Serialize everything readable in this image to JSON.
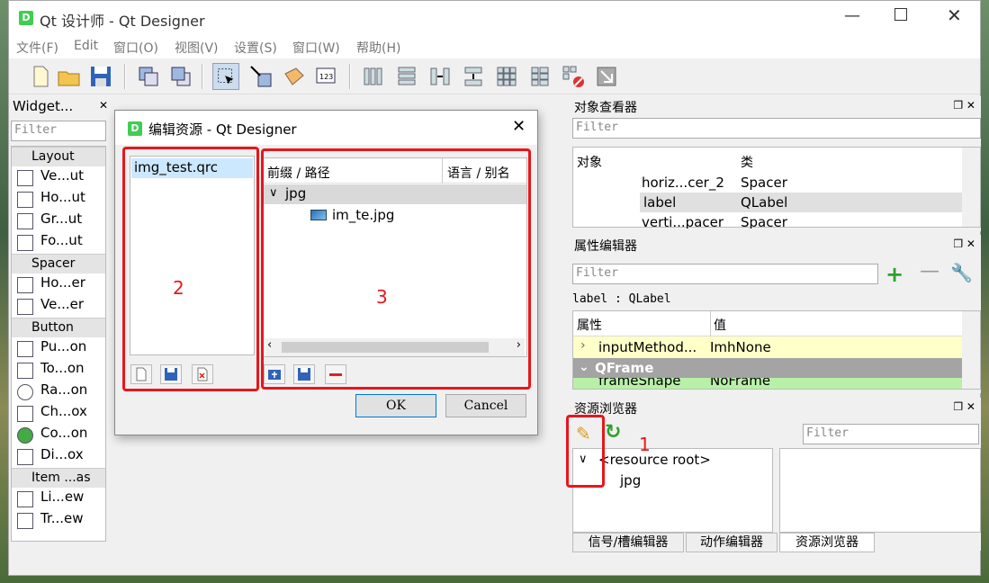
{
  "window": {
    "title": "Qt 设计师 - Qt Designer"
  },
  "menu": [
    "文件(F)",
    "Edit",
    "窗口(O)",
    "视图(V)",
    "设置(S)",
    "窗口(W)",
    "帮助(H)"
  ],
  "widget_box": {
    "title": "Widget...",
    "filter_placeholder": "Filter",
    "categories": [
      "Layout",
      "Spacer",
      "Button",
      "Item ...as"
    ],
    "layouts": [
      "Ve...ut",
      "Ho...ut",
      "Gr...ut",
      "Fo...ut"
    ],
    "spacers": [
      "Ho...er",
      "Ve...er"
    ],
    "buttons": [
      "Pu...on",
      "To...on",
      "Ra...on",
      "Ch...ox",
      "Co...on",
      "Di...ox"
    ],
    "items": [
      "Li...ew",
      "Tr...ew"
    ]
  },
  "object_inspector": {
    "title": "对象查看器",
    "filter_placeholder": "Filter",
    "col_object": "对象",
    "col_class": "类",
    "rows": [
      {
        "object": "horiz...cer_2",
        "class": "Spacer"
      },
      {
        "object": "label",
        "class": "QLabel"
      },
      {
        "object": "verti...pacer",
        "class": "Spacer"
      }
    ]
  },
  "property_editor": {
    "title": "属性编辑器",
    "filter_placeholder": "Filter",
    "context": "label : QLabel",
    "col_prop": "属性",
    "col_value": "值",
    "rows": [
      {
        "prop": "inputMethod...",
        "value": "ImhNone"
      },
      {
        "section": "QFrame"
      },
      {
        "prop": "frameShape",
        "value": "NoFrame"
      }
    ]
  },
  "resource_browser": {
    "title": "资源浏览器",
    "filter_placeholder": "Filter",
    "root": "<resource root>",
    "child": "jpg"
  },
  "bottom_tabs": [
    "信号/槽编辑器",
    "动作编辑器",
    "资源浏览器"
  ],
  "dialog": {
    "title": "编辑资源 - Qt Designer",
    "file": "img_test.qrc",
    "col_prefix": "前缀 / 路径",
    "col_lang": "语言 / 别名",
    "prefix": "jpg",
    "file_entry": "im_te.jpg",
    "ok": "OK",
    "cancel": "Cancel"
  },
  "annotations": [
    "1",
    "2",
    "3"
  ],
  "colors": {
    "annotation": "#e8161b",
    "qt_green": "#41cd52",
    "selection": "#cce8ff",
    "prop_yellow": "#ffffc8",
    "section_gray": "#a4a4a4"
  }
}
